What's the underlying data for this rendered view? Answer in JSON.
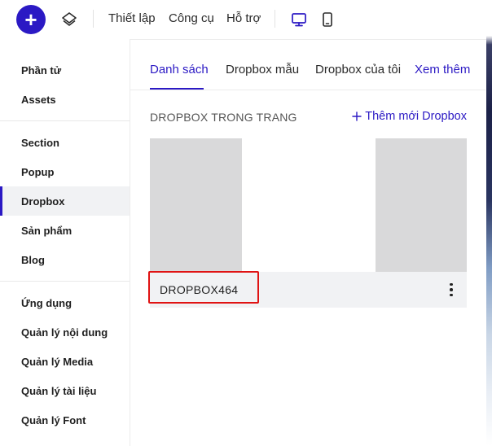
{
  "topbar": {
    "add_icon": "plus-icon",
    "layers_icon": "layers-icon",
    "menu": [
      "Thiết lập",
      "Công cụ",
      "Hỗ trợ"
    ],
    "desktop_icon": "desktop-icon",
    "mobile_icon": "mobile-icon",
    "accent": "#2b19c4"
  },
  "sidebar": {
    "groups": [
      [
        "Phần tử",
        "Assets"
      ],
      [
        "Section",
        "Popup",
        "Dropbox",
        "Sản phẩm",
        "Blog"
      ],
      [
        "Ứng dụng",
        "Quản lý nội dung",
        "Quản lý Media",
        "Quản lý tài liệu",
        "Quản lý Font"
      ]
    ],
    "active": "Dropbox"
  },
  "tabs": [
    "Danh sách",
    "Dropbox mẫu",
    "Dropbox của tôi",
    "Xem thêm"
  ],
  "active_tab": "Danh sách",
  "section": {
    "title": "DROPBOX TRONG TRANG",
    "add_new": "Thêm mới Dropbox"
  },
  "cards": [
    {
      "name": "DROPBOX464",
      "menu_icon": "kebab-menu-icon",
      "highlighted": true,
      "highlight_color": "#e01313"
    }
  ]
}
